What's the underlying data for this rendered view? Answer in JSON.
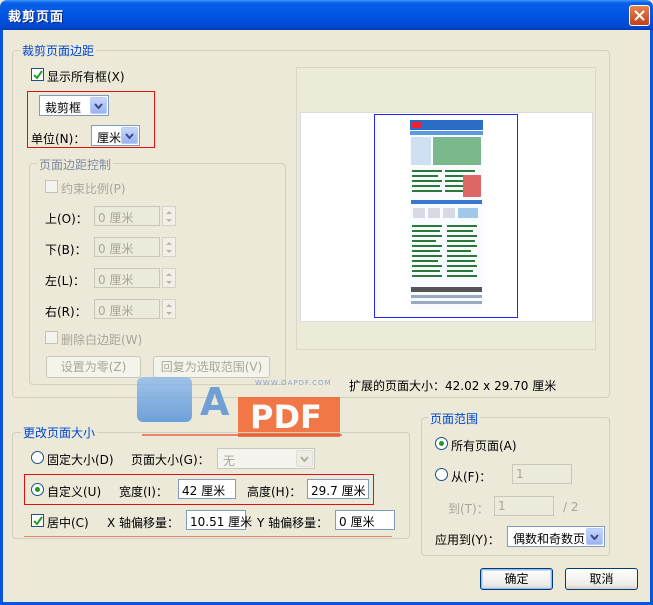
{
  "window": {
    "title": "裁剪页面"
  },
  "crop_margins": {
    "legend": "裁剪页面边距",
    "show_all_boxes": {
      "label": "显示所有框(X)",
      "checked": true
    },
    "box_select": {
      "value": "裁剪框"
    },
    "unit_label": "单位(N)：",
    "unit_select": {
      "value": "厘米"
    }
  },
  "margin_control": {
    "legend": "页面边距控制",
    "constrain": "约束比例(P)",
    "top_label": "上(O)：",
    "top_value": "0 厘米",
    "bottom_label": "下(B)：",
    "bottom_value": "0 厘米",
    "left_label": "左(L)：",
    "left_value": "0 厘米",
    "right_label": "右(R)：",
    "right_value": "0 厘米",
    "remove_white": "删除白边距(W)",
    "set_zero": "设置为零(Z)",
    "restore": "回复为选取范围(V)"
  },
  "preview": {
    "extended_size_label": "扩展的页面大小：42.02 x 29.70 厘米"
  },
  "page_size": {
    "legend": "更改页面大小",
    "fixed_size": "固定大小(D)",
    "page_size_label": "页面大小(G)：",
    "page_size_value": "无",
    "custom": "自定义(U)",
    "width_label": "宽度(I)：",
    "width_value": "42 厘米",
    "height_label": "高度(H)：",
    "height_value": "29.7 厘米",
    "center": {
      "label": "居中(C)",
      "checked": true
    },
    "x_offset_label": "X 轴偏移量：",
    "x_offset_value": "10.51 厘米",
    "y_offset_label": "Y 轴偏移量：",
    "y_offset_value": "0 厘米",
    "selected": "custom"
  },
  "page_range": {
    "legend": "页面范围",
    "all_pages": "所有页面(A)",
    "from_label": "从(F)：",
    "from_value": "1",
    "to_label": "到(T)：",
    "to_value": "1",
    "total": "/ 2",
    "apply_label": "应用到(Y)：",
    "apply_value": "偶数和奇数页",
    "selected": "all"
  },
  "buttons": {
    "ok": "确定",
    "cancel": "取消"
  },
  "watermark": {
    "a": "A",
    "pdf": "PDF",
    "url": "WWW.OAPDF.COM"
  }
}
